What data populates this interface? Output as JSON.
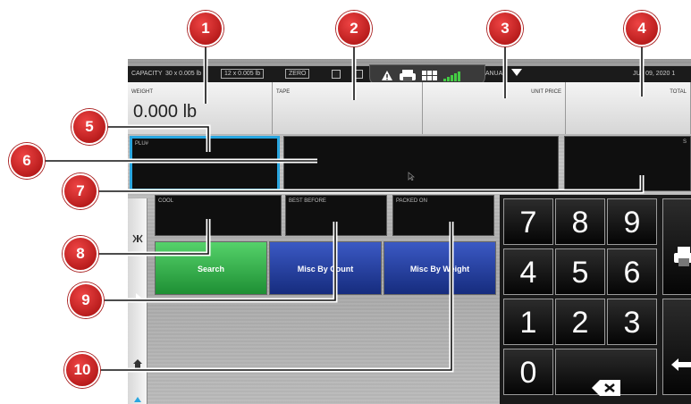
{
  "status_bar": {
    "capacity_label": "CAPACITY",
    "capacity_value": "30 x 0.005 lb",
    "division_box": "12 x 0.005 lb",
    "zero_box": "ZERO",
    "mode_label": "MANUAL",
    "date_text": "JUL 09, 2020 1"
  },
  "header": {
    "weight_label": "WEIGHT",
    "weight_value": "0.000 lb",
    "tape_label": "TAPE",
    "unit_price_label": "UNIT PRICE",
    "total_label": "TOTAL"
  },
  "fields": {
    "plu_label": "PLU#",
    "side_label": "S",
    "cool_label": "COOL",
    "best_before_label": "BEST BEFORE",
    "packed_on_label": "PACKED ON"
  },
  "buttons": {
    "search": "Search",
    "misc_by_count": "Misc By Count",
    "misc_by_weight": "Misc By Weight"
  },
  "keypad": {
    "keys": [
      "7",
      "8",
      "9",
      "4",
      "5",
      "6",
      "1",
      "2",
      "3",
      "0"
    ]
  },
  "callouts": [
    "1",
    "2",
    "3",
    "4",
    "5",
    "6",
    "7",
    "8",
    "9",
    "10"
  ],
  "colors": {
    "callout_red": "#c41a1a",
    "search_green": "#2fb34a",
    "misc_blue": "#1f3a9a",
    "plu_highlight": "#29a6e0"
  }
}
